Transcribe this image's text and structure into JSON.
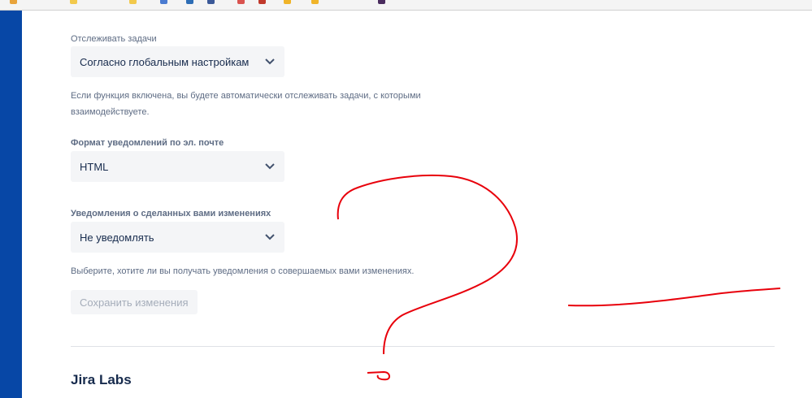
{
  "track_issues": {
    "label": "Отслеживать задачи",
    "value": "Согласно глобальным настройкам",
    "help": "Если функция включена, вы будете автоматически отслеживать задачи, с которыми взаимодействуете."
  },
  "email_format": {
    "label": "Формат уведомлений по эл. почте",
    "value": "HTML"
  },
  "own_changes": {
    "label": "Уведомления о сделанных вами изменениях",
    "value": "Не уведомлять",
    "help": "Выберите, хотите ли вы получать уведомления о совершаемых вами изменениях."
  },
  "save_label": "Сохранить изменения",
  "section_title": "Jira Labs",
  "colors": {
    "sidebar": "#0747a6",
    "annotation": "#e8000b",
    "select_bg": "#f4f5f7"
  }
}
